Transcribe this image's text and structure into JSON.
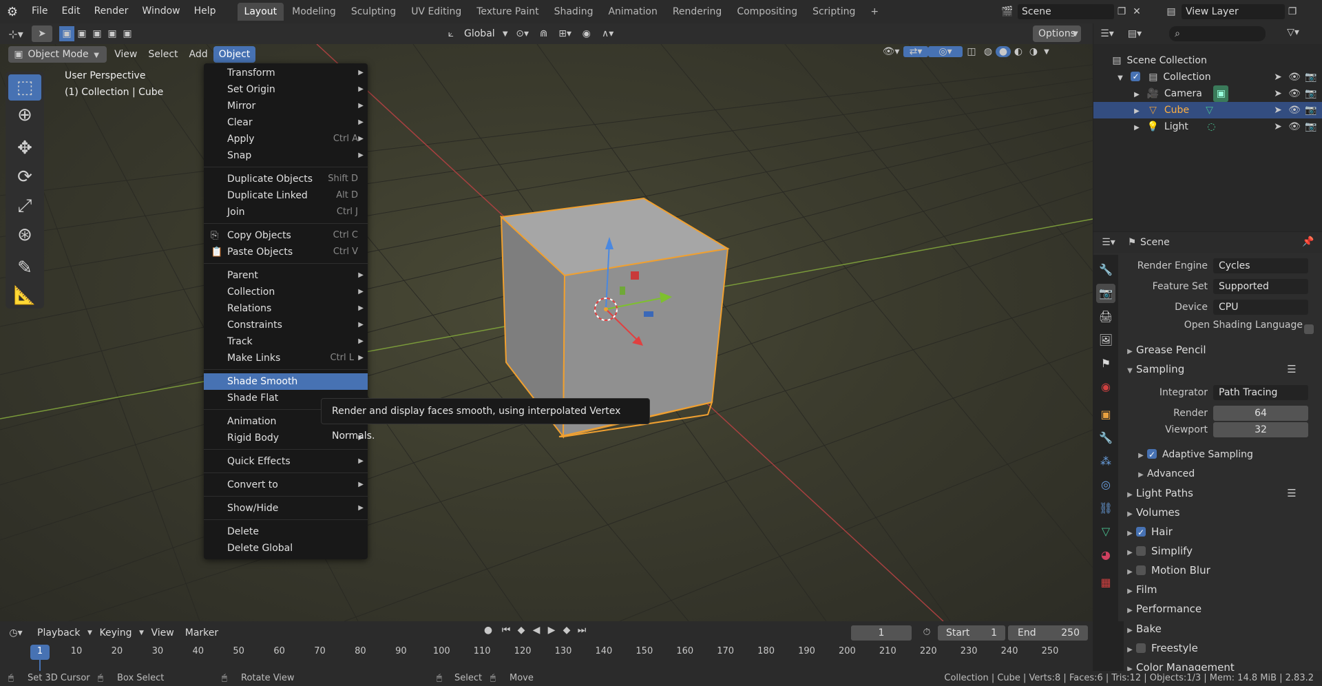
{
  "topbar": {
    "menus": [
      "File",
      "Edit",
      "Render",
      "Window",
      "Help"
    ],
    "workspaces": [
      "Layout",
      "Modeling",
      "Sculpting",
      "UV Editing",
      "Texture Paint",
      "Shading",
      "Animation",
      "Rendering",
      "Compositing",
      "Scripting"
    ],
    "active_workspace": "Layout",
    "add_tab": "+",
    "scene_name": "Scene",
    "view_layer": "View Layer"
  },
  "header": {
    "transform_orientation": "Global",
    "options": "Options",
    "mode": "Object Mode",
    "menus": [
      "View",
      "Select",
      "Add",
      "Object"
    ],
    "active_menu": "Object"
  },
  "viewport": {
    "perspective": "User Perspective",
    "collection_info": "(1) Collection | Cube"
  },
  "object_menu": {
    "items": [
      {
        "label": "Transform",
        "submenu": true
      },
      {
        "label": "Set Origin",
        "submenu": true
      },
      {
        "label": "Mirror",
        "submenu": true
      },
      {
        "label": "Clear",
        "submenu": true
      },
      {
        "label": "Apply",
        "shortcut": "Ctrl A",
        "submenu": true
      },
      {
        "label": "Snap",
        "submenu": true
      },
      {
        "label": "Duplicate Objects",
        "shortcut": "Shift D"
      },
      {
        "label": "Duplicate Linked",
        "shortcut": "Alt D"
      },
      {
        "label": "Join",
        "shortcut": "Ctrl J"
      },
      {
        "label": "Copy Objects",
        "shortcut": "Ctrl C"
      },
      {
        "label": "Paste Objects",
        "shortcut": "Ctrl V"
      },
      {
        "label": "Parent",
        "submenu": true
      },
      {
        "label": "Collection",
        "submenu": true
      },
      {
        "label": "Relations",
        "submenu": true
      },
      {
        "label": "Constraints",
        "submenu": true
      },
      {
        "label": "Track",
        "submenu": true
      },
      {
        "label": "Make Links",
        "shortcut": "Ctrl L",
        "submenu": true
      },
      {
        "label": "Shade Smooth",
        "highlighted": true
      },
      {
        "label": "Shade Flat"
      },
      {
        "label": "Animation",
        "submenu": true
      },
      {
        "label": "Rigid Body",
        "submenu": true
      },
      {
        "label": "Quick Effects",
        "submenu": true
      },
      {
        "label": "Convert to",
        "submenu": true
      },
      {
        "label": "Show/Hide",
        "submenu": true
      },
      {
        "label": "Delete"
      },
      {
        "label": "Delete Global"
      }
    ],
    "tooltip": "Render and display faces smooth, using interpolated Vertex Normals."
  },
  "outliner": {
    "root": "Scene Collection",
    "collection": "Collection",
    "objects": [
      "Camera",
      "Cube",
      "Light"
    ],
    "selected": "Cube"
  },
  "properties": {
    "context": "Scene",
    "render_engine_label": "Render Engine",
    "render_engine": "Cycles",
    "feature_set_label": "Feature Set",
    "feature_set": "Supported",
    "device_label": "Device",
    "device": "CPU",
    "osl_label": "Open Shading Language",
    "panels": {
      "grease_pencil": "Grease Pencil",
      "sampling": "Sampling",
      "integrator_label": "Integrator",
      "integrator": "Path Tracing",
      "render_label": "Render",
      "render_samples": "64",
      "viewport_label": "Viewport",
      "viewport_samples": "32",
      "adaptive_sampling": "Adaptive Sampling",
      "advanced": "Advanced",
      "light_paths": "Light Paths",
      "volumes": "Volumes",
      "hair": "Hair",
      "simplify": "Simplify",
      "motion_blur": "Motion Blur",
      "film": "Film",
      "performance": "Performance",
      "bake": "Bake",
      "freestyle": "Freestyle",
      "color_management": "Color Management"
    }
  },
  "timeline": {
    "menus": [
      "Playback",
      "Keying",
      "View",
      "Marker"
    ],
    "current_frame": "1",
    "start_label": "Start",
    "start": "1",
    "end_label": "End",
    "end": "250",
    "ticks": [
      "1",
      "10",
      "20",
      "30",
      "40",
      "50",
      "60",
      "70",
      "80",
      "90",
      "100",
      "110",
      "120",
      "130",
      "140",
      "150",
      "160",
      "170",
      "180",
      "190",
      "200",
      "210",
      "220",
      "230",
      "240",
      "250"
    ]
  },
  "statusbar": {
    "hint1": "Set 3D Cursor",
    "hint2": "Box Select",
    "hint3": "Rotate View",
    "hint4": "Select",
    "hint5": "Move",
    "stats": "Collection | Cube | Verts:8 | Faces:6 | Tris:12 | Objects:1/3 | Mem: 14.8 MiB | 2.83.2"
  }
}
